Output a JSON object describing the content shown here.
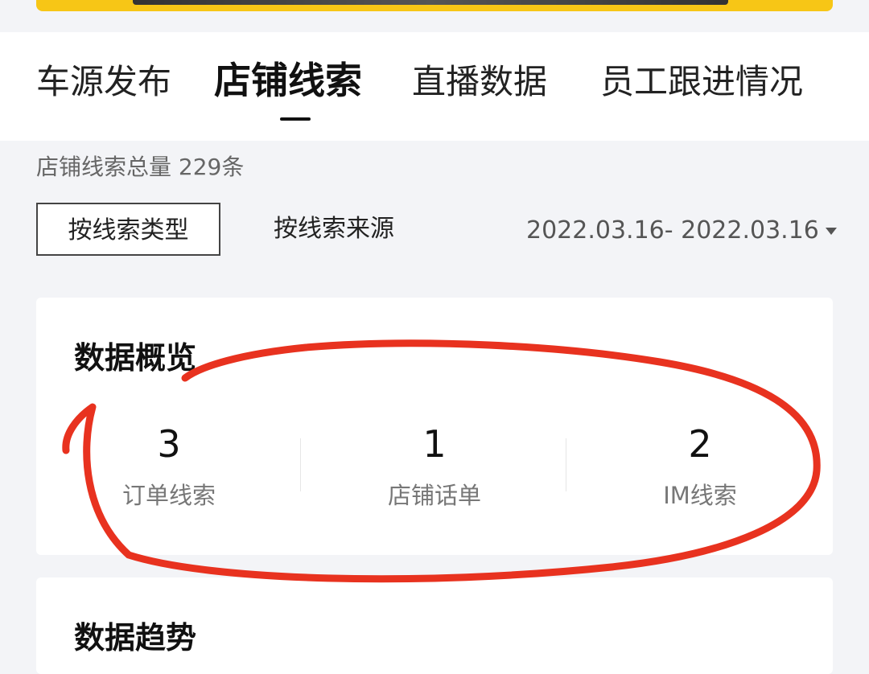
{
  "tabs": [
    {
      "label": "车源发布"
    },
    {
      "label": "店铺线索"
    },
    {
      "label": "直播数据"
    },
    {
      "label": "员工跟进情况"
    }
  ],
  "summary": "店铺线索总量 229条",
  "filters": {
    "by_type": "按线索类型",
    "by_source": "按线索来源",
    "date_range": "2022.03.16- 2022.03.16"
  },
  "overview": {
    "title": "数据概览",
    "stats": [
      {
        "value": "3",
        "label": "订单线索"
      },
      {
        "value": "1",
        "label": "店铺话单"
      },
      {
        "value": "2",
        "label": "IM线索"
      }
    ]
  },
  "trend": {
    "title": "数据趋势"
  },
  "colors": {
    "banner": "#f7c616",
    "annotation": "#e8321f"
  }
}
